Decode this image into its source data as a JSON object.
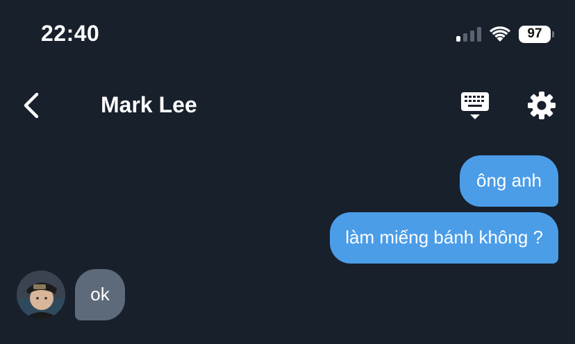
{
  "status_bar": {
    "time": "22:40",
    "signal_bars_active": 1,
    "signal_bars_total": 4,
    "battery": "97"
  },
  "header": {
    "back_icon": "chevron-left-icon",
    "title": "Mark Lee",
    "keyboard_icon": "keyboard-icon",
    "settings_icon": "gear-icon"
  },
  "messages": [
    {
      "direction": "outgoing",
      "text": "ông anh"
    },
    {
      "direction": "outgoing",
      "text": "làm miếng bánh không ?"
    },
    {
      "direction": "incoming",
      "text": "ok"
    }
  ],
  "colors": {
    "background": "#18202c",
    "outgoing_bubble": "#4b9de8",
    "incoming_bubble": "#5d6a7a",
    "text": "#ffffff"
  }
}
